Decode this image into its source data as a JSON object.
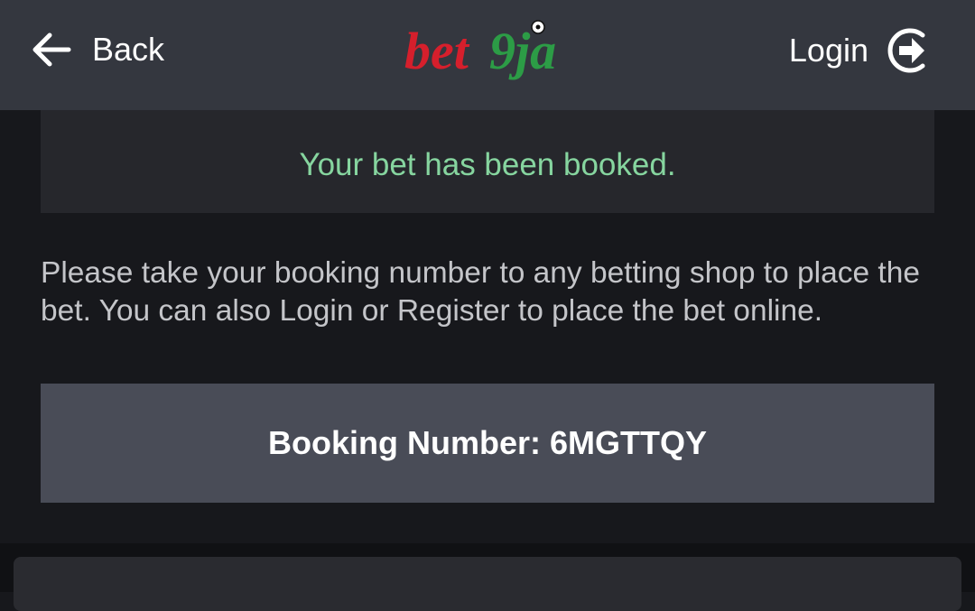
{
  "header": {
    "back_label": "Back",
    "brand_part1": "bet",
    "brand_part2": "9ja",
    "login_label": "Login"
  },
  "notice": {
    "message": "Your bet has been booked."
  },
  "info": {
    "text": "Please take your booking number to any betting shop to place the bet. You can also Login or Register to place the bet online."
  },
  "booking": {
    "label": "Booking Number: 6MGTTQY"
  },
  "colors": {
    "header_bg": "#34373f",
    "page_bg": "#17181c",
    "success_green": "#86d59f",
    "brand_red": "#d61f2c",
    "brand_green": "#2c9c46",
    "booking_bg": "#494c57"
  }
}
